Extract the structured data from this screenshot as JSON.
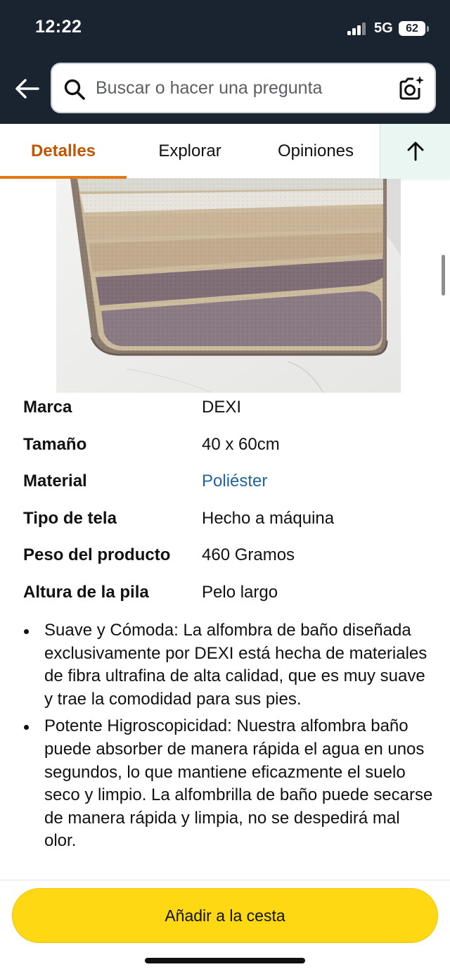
{
  "status_bar": {
    "time": "12:22",
    "network": "5G",
    "battery": "62"
  },
  "header": {
    "back_icon": "arrow-left-icon",
    "search": {
      "placeholder": "Buscar o hacer una pregunta",
      "value": ""
    },
    "camera_icon": "camera-search-icon"
  },
  "tabs": [
    {
      "label": "Detalles",
      "active": true
    },
    {
      "label": "Explorar",
      "active": false
    },
    {
      "label": "Opiniones",
      "active": false
    }
  ],
  "scroll_top_icon": "arrow-up-icon",
  "specs": [
    {
      "label": "Marca",
      "value": "DEXI"
    },
    {
      "label": "Tamaño",
      "value": "40 x 60cm"
    },
    {
      "label": "Material",
      "value": "Poliéster"
    },
    {
      "label": "Tipo de tela",
      "value": "Hecho a máquina"
    },
    {
      "label": "Peso del producto",
      "value": "460 Gramos"
    },
    {
      "label": "Altura de la pila",
      "value": "Pelo largo"
    }
  ],
  "bullets": [
    "Suave y Cómoda: La alfombra de baño diseñada exclusivamente por DEXI está hecha de materiales de fibra ultrafina de alta calidad, que es muy suave y trae la comodidad para sus pies.",
    "Potente Higroscopicidad: Nuestra alfombra baño puede absorber de manera rápida el agua en unos segundos, lo que mantiene eficazmente el suelo seco y limpio. La alfombrilla de baño puede secarse de manera rápida y limpia, no se despedirá mal olor."
  ],
  "cart_button": "Añadir a la cesta",
  "colors": {
    "header_bg": "#1a2330",
    "active_tab": "#c45500",
    "tab_underline": "#e47911",
    "link": "#2162a1",
    "cart_button": "#ffd814"
  }
}
